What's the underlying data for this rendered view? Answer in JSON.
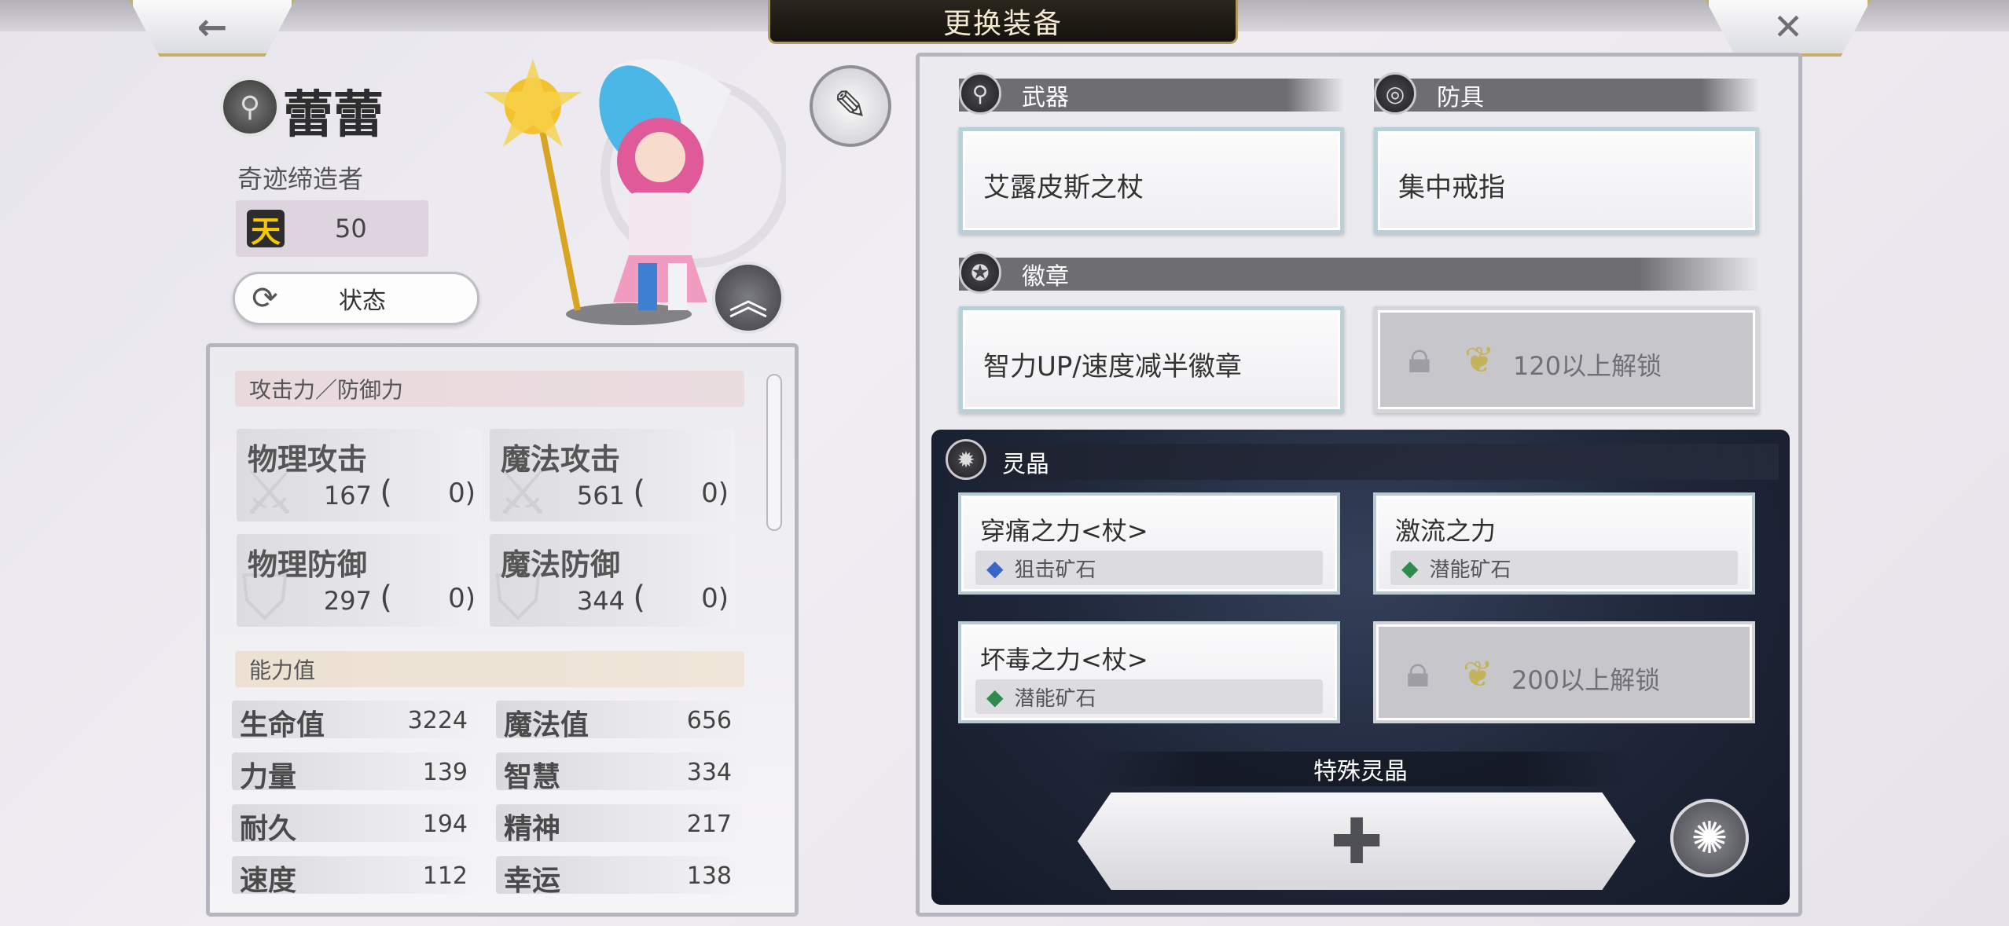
{
  "header": {
    "title": "更换装备",
    "back_icon": "←",
    "close_icon": "✕"
  },
  "character": {
    "name": "蕾蕾",
    "subtitle": "奇迹缔造者",
    "level_icon": "天",
    "level": "50",
    "status_label": "状态"
  },
  "stats": {
    "attack_defense_header": "攻击力／防御力",
    "cards": [
      {
        "name": "物理攻击",
        "value": "167",
        "bonus": "0"
      },
      {
        "name": "魔法攻击",
        "value": "561",
        "bonus": "0"
      },
      {
        "name": "物理防御",
        "value": "297",
        "bonus": "0"
      },
      {
        "name": "魔法防御",
        "value": "344",
        "bonus": "0"
      }
    ],
    "ability_header": "能力值",
    "abilities": [
      {
        "name": "生命值",
        "value": "3224"
      },
      {
        "name": "魔法值",
        "value": "656"
      },
      {
        "name": "力量",
        "value": "139"
      },
      {
        "name": "智慧",
        "value": "334"
      },
      {
        "name": "耐久",
        "value": "194"
      },
      {
        "name": "精神",
        "value": "217"
      },
      {
        "name": "速度",
        "value": "112"
      },
      {
        "name": "幸运",
        "value": "138"
      }
    ]
  },
  "equipment": {
    "weapon_label": "武器",
    "weapon": "艾露皮斯之杖",
    "armor_label": "防具",
    "armor": "集中戒指",
    "badge_label": "徽章",
    "badge": "智力UP/速度减半徽章",
    "badge_locked": "120以上解锁"
  },
  "spirit": {
    "label": "灵晶",
    "slots": [
      {
        "name": "穿痛之力<杖>",
        "ore": "狙击矿石"
      },
      {
        "name": "激流之力",
        "ore": "潜能矿石"
      },
      {
        "name": "坏毒之力<杖>",
        "ore": "潜能矿石"
      }
    ],
    "locked": "200以上解锁",
    "special_label": "特殊灵晶",
    "add_icon": "✚"
  }
}
